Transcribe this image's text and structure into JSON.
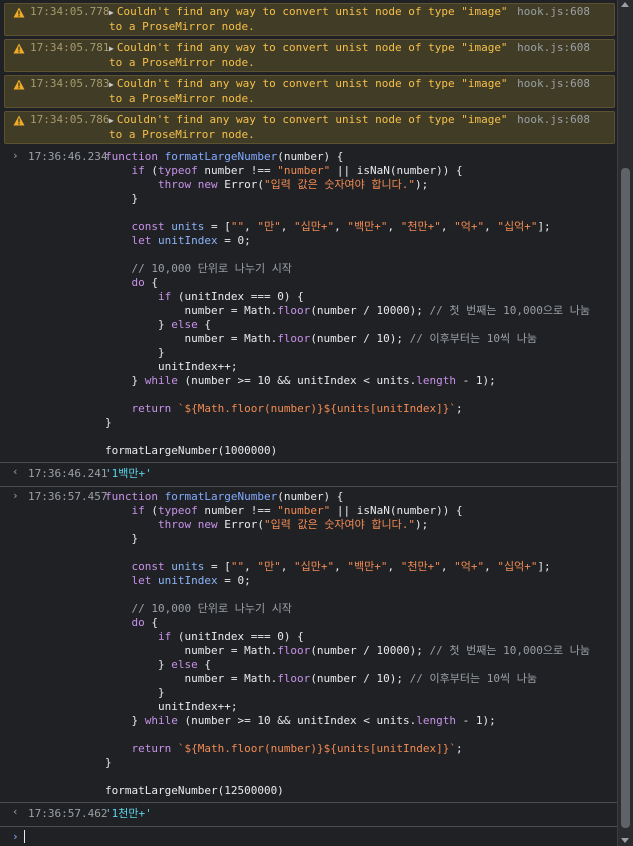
{
  "warnings": [
    {
      "timestamp": "17:34:05.778",
      "message": "Couldn't find any way to convert unist node of type \"image\" to a ProseMirror node.",
      "source": "hook.js:608"
    },
    {
      "timestamp": "17:34:05.781",
      "message": "Couldn't find any way to convert unist node of type \"image\" to a ProseMirror node.",
      "source": "hook.js:608"
    },
    {
      "timestamp": "17:34:05.783",
      "message": "Couldn't find any way to convert unist node of type \"image\" to a ProseMirror node.",
      "source": "hook.js:608"
    },
    {
      "timestamp": "17:34:05.786",
      "message": "Couldn't find any way to convert unist node of type \"image\" to a ProseMirror node.",
      "source": "hook.js:608"
    }
  ],
  "entries": [
    {
      "input_timestamp": "17:36:46.234",
      "call": "formatLargeNumber(1000000)",
      "output_timestamp": "17:36:46.241",
      "output": "'1백만+'"
    },
    {
      "input_timestamp": "17:36:57.457",
      "call": "formatLargeNumber(12500000)",
      "output_timestamp": "17:36:57.462",
      "output": "'1천만+'"
    }
  ],
  "code_lines": [
    "function formatLargeNumber(number) {",
    "    if (typeof number !== \"number\" || isNaN(number)) {",
    "        throw new Error(\"입력 값은 숫자여야 합니다.\");",
    "    }",
    "",
    "    const units = [\"\", \"만\", \"십만+\", \"백만+\", \"천만+\", \"억+\", \"십억+\"];",
    "    let unitIndex = 0;",
    "",
    "    // 10,000 단위로 나누기 시작",
    "    do {",
    "        if (unitIndex === 0) {",
    "            number = Math.floor(number / 10000); // 첫 번째는 10,000으로 나눔",
    "        } else {",
    "            number = Math.floor(number / 10); // 이후부터는 10씩 나눔",
    "        }",
    "        unitIndex++;",
    "    } while (number >= 10 && unitIndex < units.length - 1);",
    "",
    "    return `${Math.floor(number)}${units[unitIndex]}`;",
    "}",
    ""
  ],
  "icons": {
    "warning": "warning-icon",
    "expand": "expand-triangle-icon",
    "input": "input-chevron-icon",
    "output": "output-chevron-icon",
    "prompt": "prompt-chevron-icon"
  },
  "colors": {
    "background": "#202124",
    "warning_bg": "#413c26",
    "warning_text": "#f5c04a",
    "keyword": "#c792ea",
    "function": "#82aaff",
    "string": "#f28b54",
    "result": "#5cd5ea"
  }
}
